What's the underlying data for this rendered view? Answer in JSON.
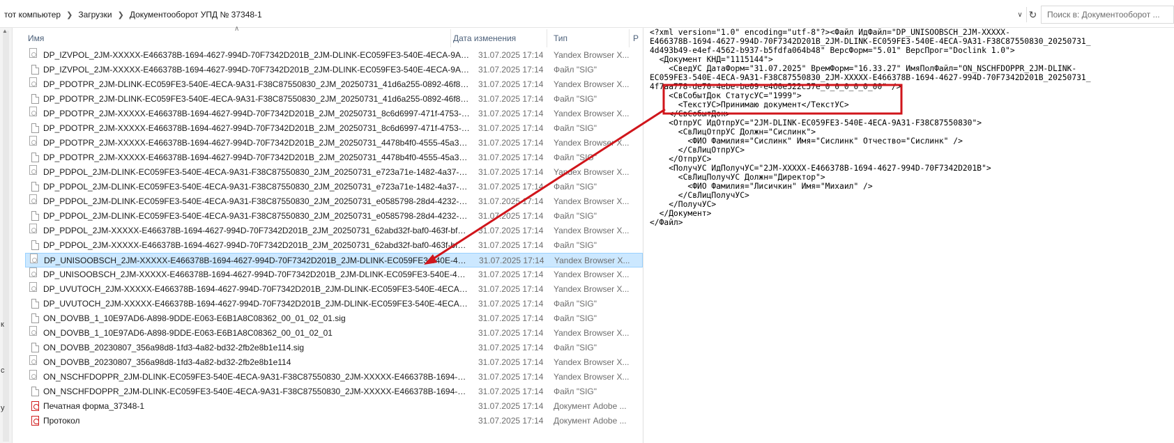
{
  "breadcrumb": {
    "items": [
      "тот компьютер",
      "Загрузки",
      "Документооборот УПД № 37348-1"
    ]
  },
  "search": {
    "placeholder": "Поиск в: Документооборот ..."
  },
  "columns": {
    "name": "Имя",
    "date": "Дата изменения",
    "type": "Тип",
    "size": "Р"
  },
  "gutter_letters": [
    "к",
    "с",
    "у"
  ],
  "files": [
    {
      "name": "DP_IZVPOL_2JM-XXXXX-E466378B-1694-4627-994D-70F7342D201B_2JM-DLINK-EC059FE3-540E-4ECA-9A31-...",
      "date": "31.07.2025 17:14",
      "type": "Yandex Browser X...",
      "icon": "xml"
    },
    {
      "name": "DP_IZVPOL_2JM-XXXXX-E466378B-1694-4627-994D-70F7342D201B_2JM-DLINK-EC059FE3-540E-4ECA-9A31-...",
      "date": "31.07.2025 17:14",
      "type": "Файл \"SIG\"",
      "icon": "sig"
    },
    {
      "name": "DP_PDOTPR_2JM-DLINK-EC059FE3-540E-4ECA-9A31-F38C87550830_2JM_20250731_41d6a255-0892-46f8-af9...",
      "date": "31.07.2025 17:14",
      "type": "Yandex Browser X...",
      "icon": "xml"
    },
    {
      "name": "DP_PDOTPR_2JM-DLINK-EC059FE3-540E-4ECA-9A31-F38C87550830_2JM_20250731_41d6a255-0892-46f8-af9...",
      "date": "31.07.2025 17:14",
      "type": "Файл \"SIG\"",
      "icon": "sig"
    },
    {
      "name": "DP_PDOTPR_2JM-XXXXX-E466378B-1694-4627-994D-70F7342D201B_2JM_20250731_8c6d6997-471f-4753-b7c...",
      "date": "31.07.2025 17:14",
      "type": "Yandex Browser X...",
      "icon": "xml"
    },
    {
      "name": "DP_PDOTPR_2JM-XXXXX-E466378B-1694-4627-994D-70F7342D201B_2JM_20250731_8c6d6997-471f-4753-b7c...",
      "date": "31.07.2025 17:14",
      "type": "Файл \"SIG\"",
      "icon": "sig"
    },
    {
      "name": "DP_PDOTPR_2JM-XXXXX-E466378B-1694-4627-994D-70F7342D201B_2JM_20250731_4478b4f0-4555-45a3-ae0...",
      "date": "31.07.2025 17:14",
      "type": "Yandex Browser X...",
      "icon": "xml"
    },
    {
      "name": "DP_PDOTPR_2JM-XXXXX-E466378B-1694-4627-994D-70F7342D201B_2JM_20250731_4478b4f0-4555-45a3-ae0...",
      "date": "31.07.2025 17:14",
      "type": "Файл \"SIG\"",
      "icon": "sig"
    },
    {
      "name": "DP_PDPOL_2JM-DLINK-EC059FE3-540E-4ECA-9A31-F38C87550830_2JM_20250731_e723a71e-1482-4a37-9d8...",
      "date": "31.07.2025 17:14",
      "type": "Yandex Browser X...",
      "icon": "xml"
    },
    {
      "name": "DP_PDPOL_2JM-DLINK-EC059FE3-540E-4ECA-9A31-F38C87550830_2JM_20250731_e723a71e-1482-4a37-9d8...",
      "date": "31.07.2025 17:14",
      "type": "Файл \"SIG\"",
      "icon": "sig"
    },
    {
      "name": "DP_PDPOL_2JM-DLINK-EC059FE3-540E-4ECA-9A31-F38C87550830_2JM_20250731_e0585798-28d4-4232-a99...",
      "date": "31.07.2025 17:14",
      "type": "Yandex Browser X...",
      "icon": "xml"
    },
    {
      "name": "DP_PDPOL_2JM-DLINK-EC059FE3-540E-4ECA-9A31-F38C87550830_2JM_20250731_e0585798-28d4-4232-a99...",
      "date": "31.07.2025 17:14",
      "type": "Файл \"SIG\"",
      "icon": "sig"
    },
    {
      "name": "DP_PDPOL_2JM-XXXXX-E466378B-1694-4627-994D-70F7342D201B_2JM_20250731_62abd32f-baf0-463f-bf85...",
      "date": "31.07.2025 17:14",
      "type": "Yandex Browser X...",
      "icon": "xml"
    },
    {
      "name": "DP_PDPOL_2JM-XXXXX-E466378B-1694-4627-994D-70F7342D201B_2JM_20250731_62abd32f-baf0-463f-bf85...",
      "date": "31.07.2025 17:14",
      "type": "Файл \"SIG\"",
      "icon": "sig"
    },
    {
      "name": "DP_UNISOOBSCH_2JM-XXXXX-E466378B-1694-4627-994D-70F7342D201B_2JM-DLINK-EC059FE3-540E-4ECA...",
      "date": "31.07.2025 17:14",
      "type": "Yandex Browser X...",
      "icon": "xml",
      "selected": true
    },
    {
      "name": "DP_UNISOOBSCH_2JM-XXXXX-E466378B-1694-4627-994D-70F7342D201B_2JM-DLINK-EC059FE3-540E-4ECA...",
      "date": "31.07.2025 17:14",
      "type": "Yandex Browser X...",
      "icon": "xml"
    },
    {
      "name": "DP_UVUTOCH_2JM-XXXXX-E466378B-1694-4627-994D-70F7342D201B_2JM-DLINK-EC059FE3-540E-4ECA-9A...",
      "date": "31.07.2025 17:14",
      "type": "Yandex Browser X...",
      "icon": "xml"
    },
    {
      "name": "DP_UVUTOCH_2JM-XXXXX-E466378B-1694-4627-994D-70F7342D201B_2JM-DLINK-EC059FE3-540E-4ECA-9A...",
      "date": "31.07.2025 17:14",
      "type": "Файл \"SIG\"",
      "icon": "sig"
    },
    {
      "name": "ON_DOVBB_1_10E97AD6-A898-9DDE-E063-E6B1A8C08362_00_01_02_01.sig",
      "date": "31.07.2025 17:14",
      "type": "Файл \"SIG\"",
      "icon": "sig"
    },
    {
      "name": "ON_DOVBB_1_10E97AD6-A898-9DDE-E063-E6B1A8C08362_00_01_02_01",
      "date": "31.07.2025 17:14",
      "type": "Yandex Browser X...",
      "icon": "xml"
    },
    {
      "name": "ON_DOVBB_20230807_356a98d8-1fd3-4a82-bd32-2fb2e8b1e114.sig",
      "date": "31.07.2025 17:14",
      "type": "Файл \"SIG\"",
      "icon": "sig"
    },
    {
      "name": "ON_DOVBB_20230807_356a98d8-1fd3-4a82-bd32-2fb2e8b1e114",
      "date": "31.07.2025 17:14",
      "type": "Yandex Browser X...",
      "icon": "xml"
    },
    {
      "name": "ON_NSCHFDOPPR_2JM-DLINK-EC059FE3-540E-4ECA-9A31-F38C87550830_2JM-XXXXX-E466378B-1694-462...",
      "date": "31.07.2025 17:14",
      "type": "Yandex Browser X...",
      "icon": "xml"
    },
    {
      "name": "ON_NSCHFDOPPR_2JM-DLINK-EC059FE3-540E-4ECA-9A31-F38C87550830_2JM-XXXXX-E466378B-1694-462...",
      "date": "31.07.2025 17:14",
      "type": "Файл \"SIG\"",
      "icon": "sig"
    },
    {
      "name": "Печатная форма_37348-1",
      "date": "31.07.2025 17:14",
      "type": "Документ Adobe ...",
      "icon": "pdf"
    },
    {
      "name": "Протокол",
      "date": "31.07.2025 17:14",
      "type": "Документ Adobe ...",
      "icon": "pdf"
    }
  ],
  "xml_lines": [
    "<?xml version=\"1.0\" encoding=\"utf-8\"?><Файл ИдФайл=\"DP_UNISOOBSCH_2JM-XXXXX-",
    "E466378B-1694-4627-994D-70F7342D201B_2JM-DLINK-EC059FE3-540E-4ECA-9A31-F38C87550830_20250731_",
    "4d493b49-e4ef-4562-b937-b5fdfa064b48\" ВерсФорм=\"5.01\" ВерсПрог=\"Doclink 1.0\">",
    "  <Документ КНД=\"1115144\">",
    "    <СведУС ДатаФорм=\"31.07.2025\" ВремФорм=\"16.33.27\" ИмяПолФайл=\"ON_NSCHFDOPPR_2JM-DLINK-",
    "EC059FE3-540E-4ECA-9A31-F38C87550830_2JM-XXXXX-E466378B-1694-4627-994D-70F7342D201B_20250731_",
    "4f7aa778-de70-4ebe-be09-e460e522c57e_0_0_0_0_0_00\" />",
    "    <СвСобытДок СтатусУС=\"1999\">",
    "      <ТекстУС>Принимаю документ</ТекстУС>",
    "    </СвСобытДок>",
    "    <ОтпрУС ИдОтпрУС=\"2JM-DLINK-EC059FE3-540E-4ECA-9A31-F38C87550830\">",
    "      <СвЛицОтпрУС Должн=\"Сислинк\">",
    "        <ФИО Фамилия=\"Сислинк\" Имя=\"Сислинк\" Отчество=\"Сислинк\" />",
    "      </СвЛицОтпрУС>",
    "    </ОтпрУС>",
    "    <ПолучУС ИдПолучУС=\"2JM-XXXXX-E466378B-1694-4627-994D-70F7342D201B\">",
    "      <СвЛицПолучУС Должн=\"Директор\">",
    "        <ФИО Фамилия=\"Лисичкин\" Имя=\"Михаил\" />",
    "      </СвЛицПолучУС>",
    "    </ПолучУС>",
    "  </Документ>",
    "</Файл>"
  ],
  "annotation": {
    "color": "#d0151b"
  }
}
